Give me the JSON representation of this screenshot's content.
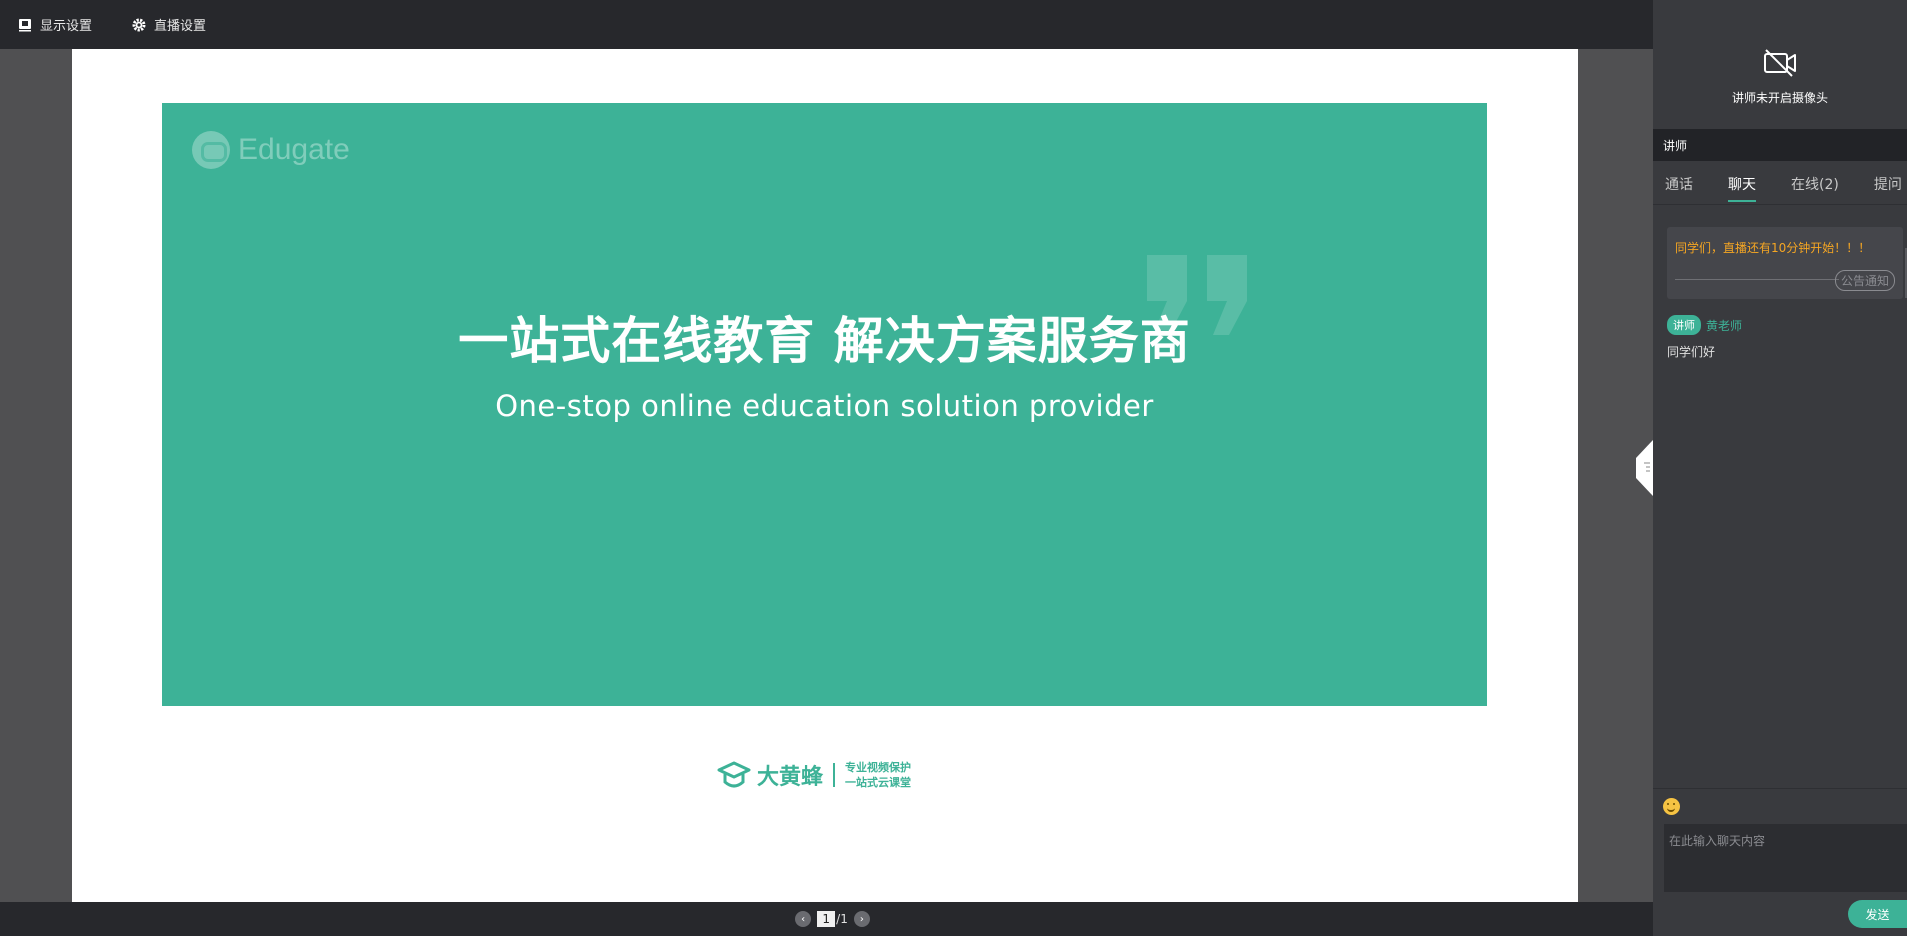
{
  "toolbar": {
    "display_settings": "显示设置",
    "live_settings": "直播设置"
  },
  "slide": {
    "brand": "Edugate",
    "headline": "一站式在线教育 解决方案服务商",
    "subline": "One-stop online education solution provider",
    "footer_name": "大黄蜂",
    "footer_slogan_1": "专业视频保护",
    "footer_slogan_2": "一站式云课堂"
  },
  "pager": {
    "current": "1",
    "total": "/1"
  },
  "panel": {
    "camera_status": "讲师未开启摄像头",
    "role_label": "讲师",
    "tabs": [
      {
        "label": "通话"
      },
      {
        "label": "聊天"
      },
      {
        "label": "在线(2)"
      },
      {
        "label": "提问"
      }
    ],
    "active_tab": "聊天",
    "notice": {
      "text": "同学们，直播还有10分钟开始！！！",
      "tag": "公告通知"
    },
    "messages": [
      {
        "role": "讲师",
        "name": "黄老师",
        "text": "同学们好"
      }
    ],
    "input_placeholder": "在此输入聊天内容",
    "send_label": "发送"
  },
  "colors": {
    "accent": "#3db297",
    "notice": "#f5a623",
    "topbar": "#27282c",
    "panel": "#393a3e"
  }
}
